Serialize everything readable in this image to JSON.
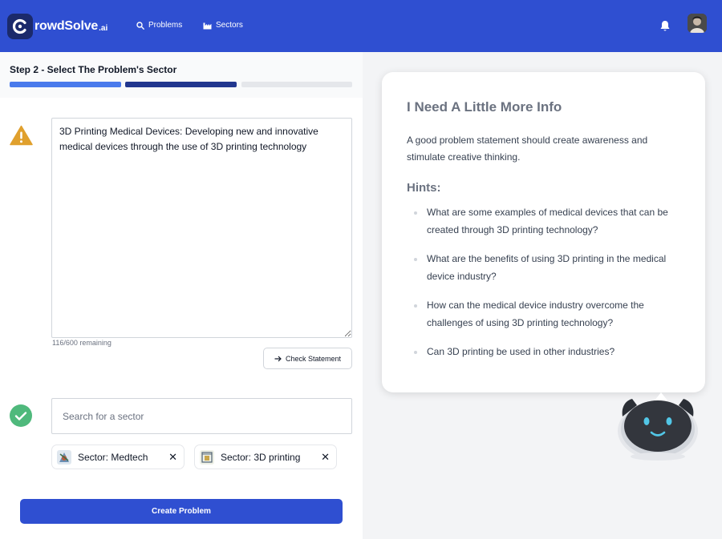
{
  "header": {
    "logo_text": "rowdSolve",
    "logo_suffix": ".ai",
    "nav": [
      {
        "label": "Problems",
        "icon": "search-icon"
      },
      {
        "label": "Sectors",
        "icon": "factory-icon"
      }
    ],
    "notification_icon": "bell-icon"
  },
  "step": {
    "title": "Step 2 - Select The Problem's Sector",
    "progress": {
      "total_steps": 3,
      "current_step": 2
    }
  },
  "statement": {
    "value": "3D Printing Medical Devices: Developing new and innovative medical devices through the use of 3D printing technology",
    "remaining": "116/600 remaining",
    "check_label": "Check Statement",
    "status_icon": "warning-icon"
  },
  "sector": {
    "status_icon": "check-circle-icon",
    "search_placeholder": "Search for a sector",
    "chips": [
      {
        "label": "Sector: Medtech",
        "remove": "✕"
      },
      {
        "label": "Sector: 3D printing",
        "remove": "✕"
      }
    ]
  },
  "actions": {
    "create_label": "Create Problem"
  },
  "info": {
    "title": "I Need A Little More Info",
    "lead": "A good problem statement should create awareness and stimulate creative thinking.",
    "hints_title": "Hints:",
    "hints": [
      "What are some examples of medical devices that can be created through 3D printing technology?",
      "What are the benefits of using 3D printing in the medical device industry?",
      "How can the medical device industry overcome the challenges of using 3D printing technology?",
      "Can 3D printing be used in other industries?"
    ]
  },
  "colors": {
    "brand": "#2f4fd1",
    "progress_done": "#4a7bec",
    "progress_current": "#22378f",
    "progress_todo": "#e5e7eb",
    "warning": "#e0a02d",
    "success": "#4fb97c"
  }
}
